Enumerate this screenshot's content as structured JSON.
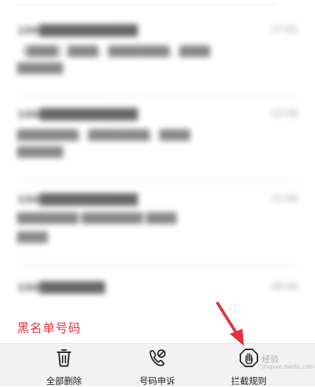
{
  "messages": [
    {
      "sender": "106████████████",
      "time": "17:02",
      "line1": "【████】████，████████，████",
      "line2": "██████"
    },
    {
      "sender": "106████████████",
      "time": "13:58",
      "line1": "████████，████████，████",
      "line2": "██████"
    },
    {
      "sender": "106████████████",
      "time": "11:06",
      "line1": "████████ ████████ ████",
      "line2": "████"
    },
    {
      "sender": "106████████",
      "time": "09:40",
      "line1": "",
      "line2": ""
    }
  ],
  "blacklist_label": "黑名单号码",
  "bottom_bar": {
    "delete_all": "全部删除",
    "number_appeal": "号码申诉",
    "intercept_rules": "拦截规则"
  },
  "watermark": {
    "text": "经验",
    "subtext": "jingyan.baidu.com"
  },
  "icons": {
    "delete": "trash-icon",
    "appeal": "phone-appeal-icon",
    "rules": "hand-stop-icon",
    "arrow": "red-arrow-annotation"
  },
  "colors": {
    "accent_red": "#e5323c",
    "bar_bg": "#f2f2f2"
  }
}
